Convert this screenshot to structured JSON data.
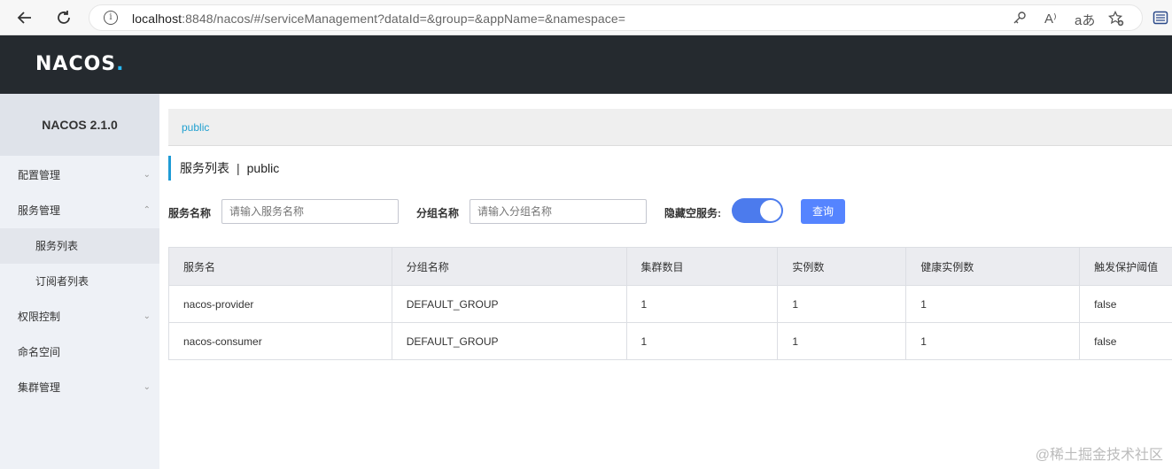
{
  "browser": {
    "url_host": "localhost",
    "url_rest": ":8848/nacos/#/serviceManagement?dataId=&group=&appName=&namespace=",
    "read_aloud": "A⁾",
    "translate": "aあ"
  },
  "header": {
    "logo": "NACOS",
    "logo_dot": "."
  },
  "sidebar": {
    "version": "NACOS 2.1.0",
    "items": [
      {
        "label": "配置管理"
      },
      {
        "label": "服务管理"
      },
      {
        "label": "服务列表"
      },
      {
        "label": "订阅者列表"
      },
      {
        "label": "权限控制"
      },
      {
        "label": "命名空间"
      },
      {
        "label": "集群管理"
      }
    ]
  },
  "main": {
    "namespace": "public",
    "title": "服务列表",
    "title_sep": "|",
    "title_ns": "public",
    "filters": {
      "service_label": "服务名称",
      "service_placeholder": "请输入服务名称",
      "group_label": "分组名称",
      "group_placeholder": "请输入分组名称",
      "hide_empty_label": "隐藏空服务:",
      "hide_empty_on": true,
      "query_label": "查询"
    },
    "table": {
      "headers": [
        "服务名",
        "分组名称",
        "集群数目",
        "实例数",
        "健康实例数",
        "触发保护阈值"
      ],
      "rows": [
        [
          "nacos-provider",
          "DEFAULT_GROUP",
          "1",
          "1",
          "1",
          "false"
        ],
        [
          "nacos-consumer",
          "DEFAULT_GROUP",
          "1",
          "1",
          "1",
          "false"
        ]
      ]
    }
  },
  "watermark": "@稀土掘金技术社区",
  "colors": {
    "accent": "#5584ff",
    "toggle": "#4c7bed",
    "topbar": "#252a2f",
    "namespace_link": "#20a0d0"
  }
}
